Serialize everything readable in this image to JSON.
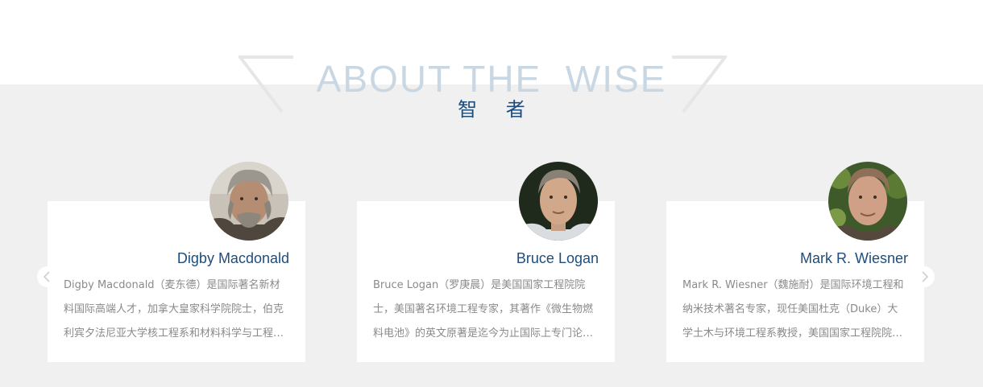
{
  "section": {
    "heading_en": "ABOUT THE  WISE",
    "heading_cn": "智 者"
  },
  "carousel": {
    "prev_label": "‹",
    "next_label": "›",
    "cards": [
      {
        "name": "Digby Macdonald",
        "description": "Digby Macdonald（麦东德）是国际著名新材料国际高端人才，加拿大皇家科学院院士，伯克利宾夕法尼亚大学核工程系和材料科学与工程系教授……"
      },
      {
        "name": "Bruce Logan",
        "description": "Bruce Logan（罗庚晨）是美国国家工程院院士，美国著名环境工程专家，其著作《微生物燃料电池》的英文原著是迄今为止国际上专门论述微生物燃料电池的著作……"
      },
      {
        "name": "Mark R. Wiesner",
        "description": "Mark R. Wiesner（魏施耐）是国际环境工程和纳米技术著名专家，现任美国杜克（Duke）大学土木与环境工程系教授，美国国家工程院院士……"
      }
    ]
  },
  "colors": {
    "accent": "#1e4d7b",
    "heading_faded": "#c9d7e3",
    "band": "#f0f0f0",
    "text_muted": "#8a8a8a"
  }
}
